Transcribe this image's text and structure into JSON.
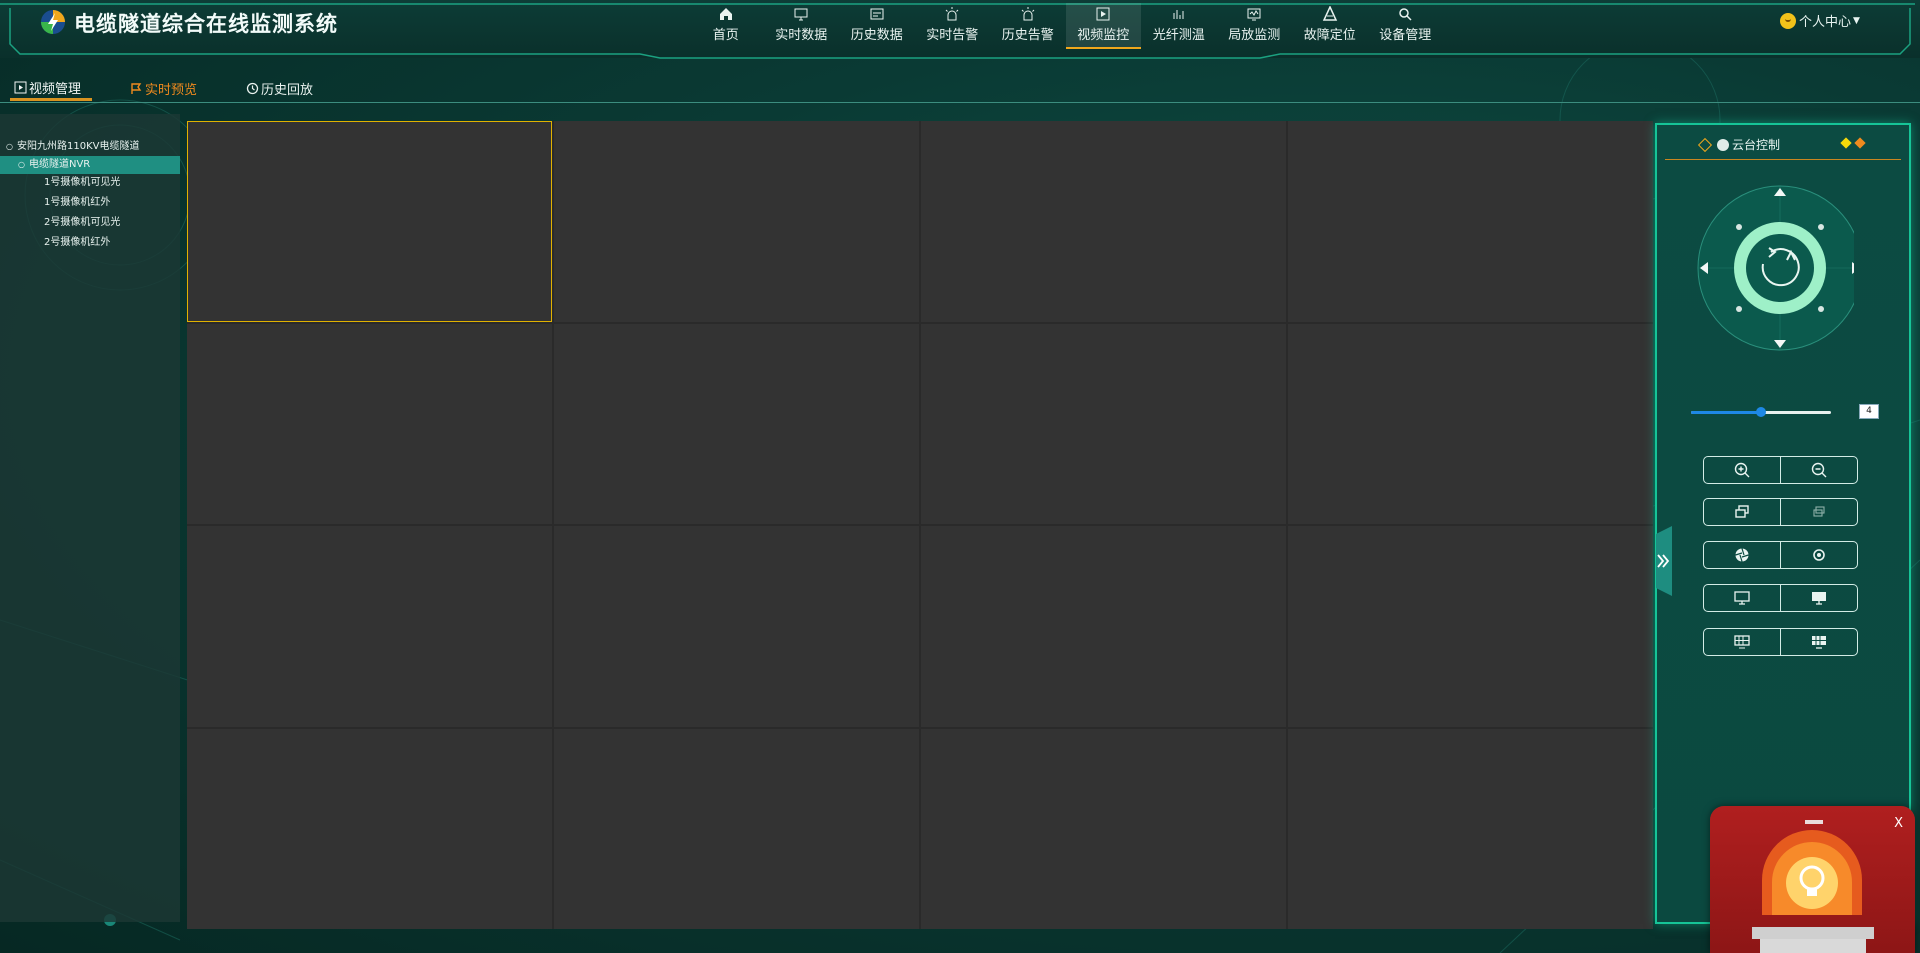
{
  "header": {
    "app_title": "电缆隧道综合在线监测系统",
    "nav": [
      {
        "label": "首页",
        "icon": "home-icon"
      },
      {
        "label": "实时数据",
        "icon": "monitor-icon"
      },
      {
        "label": "历史数据",
        "icon": "history-data-icon"
      },
      {
        "label": "实时告警",
        "icon": "alarm-light-icon"
      },
      {
        "label": "历史告警",
        "icon": "alarm-light-icon"
      },
      {
        "label": "视频监控",
        "icon": "video-icon",
        "active": true
      },
      {
        "label": "光纤测温",
        "icon": "fiber-temp-icon"
      },
      {
        "label": "局放监测",
        "icon": "discharge-monitor-icon"
      },
      {
        "label": "故障定位",
        "icon": "fault-locate-icon"
      },
      {
        "label": "设备管理",
        "icon": "device-search-icon"
      }
    ],
    "user_label": "个人中心"
  },
  "subtabs": {
    "video_manage": "视频管理",
    "live_preview": "实时预览",
    "history_playback": "历史回放"
  },
  "tree": {
    "root": "安阳九州路110KV电缆隧道",
    "nvr": "电缆隧道NVR",
    "cameras": [
      "1号摄像机可见光",
      "1号摄像机红外",
      "2号摄像机可见光",
      "2号摄像机红外"
    ]
  },
  "video_grid": {
    "rows": 4,
    "cols": 4,
    "selected_index": 0
  },
  "ptz": {
    "title": "云台控制",
    "zoom_level": "4",
    "zoom_fraction": 0.5,
    "accent_colors": {
      "yellow": "#f5d90a",
      "orange": "#f08a1e",
      "teal": "#16c497",
      "joystick_ring": "#9ef0c8"
    }
  },
  "alarm": {
    "close_label": "X"
  }
}
